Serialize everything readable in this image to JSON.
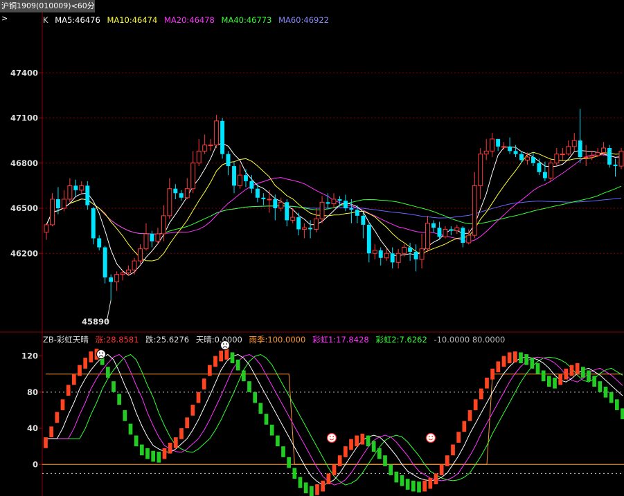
{
  "title": "沪铜1909(010009)<60分>",
  "main_legend": {
    "k": "K",
    "ma5": "MA5:46476",
    "ma10": "MA10:46474",
    "ma20": "MA20:46478",
    "ma40": "MA40:46773",
    "ma60": "MA60:46922"
  },
  "indicator_legend": {
    "name": "ZB-彩虹天晴",
    "zhang": "涨:28.8581",
    "die": "跌:25.6276",
    "tianqing": "天晴:0.0000",
    "yuji": "雨季:100.0000",
    "caihong1": "彩虹1:17.8428",
    "caihong2": "彩虹2:7.6262",
    "levels": "-10.0000 80.0000"
  },
  "colors": {
    "up": "#ff3b3b",
    "down": "#00e5ff",
    "ma5": "#ffffff",
    "ma10": "#ffff33",
    "ma20": "#ff33ff",
    "ma40": "#33ff33",
    "ma60": "#6666ff",
    "grid": "#8b0000",
    "orange": "#ff9933"
  },
  "chart_data": [
    {
      "type": "candlestick",
      "y_ticks": [
        "47400",
        "47100",
        "46800",
        "46500",
        "46200"
      ],
      "ylim": [
        45700,
        47700
      ],
      "low_label": "45890",
      "candles": [
        [
          46340,
          46390,
          46290,
          46400
        ],
        [
          46390,
          46560,
          46380,
          46600
        ],
        [
          46560,
          46500,
          46460,
          46640
        ],
        [
          46500,
          46560,
          46480,
          46620
        ],
        [
          46560,
          46650,
          46540,
          46700
        ],
        [
          46650,
          46620,
          46580,
          46690
        ],
        [
          46620,
          46650,
          46600,
          46680
        ],
        [
          46650,
          46520,
          46490,
          46680
        ],
        [
          46500,
          46300,
          46260,
          46510
        ],
        [
          46300,
          46240,
          46220,
          46320
        ],
        [
          46240,
          46040,
          46000,
          46250
        ],
        [
          46040,
          46010,
          45890,
          46060
        ],
        [
          46010,
          46060,
          45950,
          46080
        ],
        [
          46060,
          46070,
          46020,
          46090
        ],
        [
          46070,
          46090,
          46050,
          46120
        ],
        [
          46090,
          46150,
          46060,
          46170
        ],
        [
          46150,
          46230,
          46130,
          46260
        ],
        [
          46230,
          46330,
          46220,
          46400
        ],
        [
          46330,
          46280,
          46240,
          46350
        ],
        [
          46280,
          46330,
          46260,
          46370
        ],
        [
          46330,
          46450,
          46280,
          46520
        ],
        [
          46450,
          46630,
          46430,
          46700
        ],
        [
          46630,
          46600,
          46560,
          46660
        ],
        [
          46600,
          46570,
          46550,
          46620
        ],
        [
          46570,
          46630,
          46560,
          46700
        ],
        [
          46630,
          46800,
          46600,
          46880
        ],
        [
          46800,
          46880,
          46780,
          46960
        ],
        [
          46880,
          46920,
          46860,
          46990
        ],
        [
          46920,
          46920,
          46880,
          46960
        ],
        [
          46920,
          47080,
          46900,
          47120
        ],
        [
          47080,
          46860,
          46830,
          47100
        ],
        [
          46860,
          46780,
          46720,
          46880
        ],
        [
          46780,
          46650,
          46600,
          46810
        ],
        [
          46650,
          46720,
          46630,
          46790
        ],
        [
          46720,
          46680,
          46640,
          46760
        ],
        [
          46680,
          46630,
          46600,
          46720
        ],
        [
          46630,
          46570,
          46540,
          46660
        ],
        [
          46570,
          46560,
          46520,
          46600
        ],
        [
          46560,
          46560,
          46470,
          46620
        ],
        [
          46560,
          46500,
          46420,
          46590
        ],
        [
          46500,
          46540,
          46480,
          46570
        ],
        [
          46540,
          46420,
          46380,
          46560
        ],
        [
          46420,
          46440,
          46400,
          46500
        ],
        [
          46440,
          46360,
          46320,
          46470
        ],
        [
          46360,
          46370,
          46300,
          46400
        ],
        [
          46370,
          46360,
          46300,
          46420
        ],
        [
          46360,
          46430,
          46340,
          46500
        ],
        [
          46430,
          46540,
          46400,
          46580
        ],
        [
          46540,
          46530,
          46500,
          46600
        ],
        [
          46530,
          46560,
          46500,
          46600
        ],
        [
          46560,
          46550,
          46510,
          46580
        ],
        [
          46550,
          46500,
          46480,
          46590
        ],
        [
          46500,
          46490,
          46400,
          46560
        ],
        [
          46490,
          46450,
          46400,
          46520
        ],
        [
          46450,
          46390,
          46300,
          46470
        ],
        [
          46390,
          46200,
          46140,
          46400
        ],
        [
          46200,
          46220,
          46160,
          46260
        ],
        [
          46220,
          46170,
          46120,
          46240
        ],
        [
          46170,
          46200,
          46150,
          46230
        ],
        [
          46200,
          46140,
          46100,
          46240
        ],
        [
          46140,
          46200,
          46100,
          46230
        ],
        [
          46200,
          46240,
          46180,
          46260
        ],
        [
          46240,
          46210,
          46150,
          46270
        ],
        [
          46210,
          46160,
          46080,
          46260
        ],
        [
          46160,
          46230,
          46100,
          46330
        ],
        [
          46230,
          46400,
          46210,
          46450
        ],
        [
          46400,
          46370,
          46340,
          46420
        ],
        [
          46370,
          46310,
          46290,
          46410
        ],
        [
          46310,
          46360,
          46300,
          46380
        ],
        [
          46360,
          46350,
          46320,
          46380
        ],
        [
          46350,
          46370,
          46330,
          46390
        ],
        [
          46370,
          46270,
          46240,
          46380
        ],
        [
          46270,
          46320,
          46260,
          46360
        ],
        [
          46320,
          46650,
          46300,
          46740
        ],
        [
          46650,
          46860,
          46560,
          46900
        ],
        [
          46860,
          46880,
          46820,
          46960
        ],
        [
          46880,
          46960,
          46840,
          47000
        ],
        [
          46960,
          46910,
          46880,
          46960
        ],
        [
          46910,
          46910,
          46890,
          46940
        ],
        [
          46910,
          46880,
          46860,
          46970
        ],
        [
          46880,
          46860,
          46840,
          46920
        ],
        [
          46860,
          46820,
          46800,
          46880
        ],
        [
          46820,
          46840,
          46790,
          46870
        ],
        [
          46840,
          46800,
          46780,
          46870
        ],
        [
          46800,
          46740,
          46720,
          46830
        ],
        [
          46740,
          46700,
          46680,
          46810
        ],
        [
          46700,
          46800,
          46680,
          46830
        ],
        [
          46800,
          46860,
          46780,
          46900
        ],
        [
          46860,
          46860,
          46820,
          46900
        ],
        [
          46860,
          46910,
          46850,
          46950
        ],
        [
          46910,
          46950,
          46880,
          47000
        ],
        [
          46950,
          46840,
          46800,
          47160
        ],
        [
          46840,
          46840,
          46780,
          46920
        ],
        [
          46840,
          46850,
          46820,
          46880
        ],
        [
          46850,
          46870,
          46840,
          46900
        ],
        [
          46870,
          46900,
          46850,
          46940
        ],
        [
          46900,
          46790,
          46770,
          46920
        ],
        [
          46790,
          46780,
          46710,
          46830
        ],
        [
          46780,
          46880,
          46760,
          46900
        ]
      ]
    },
    {
      "type": "oscillator",
      "name": "ZB-彩虹天晴",
      "y_ticks": [
        "120",
        "80",
        "40",
        "0"
      ],
      "ylim": [
        -35,
        135
      ],
      "levels": [
        -10,
        80
      ],
      "bars": [
        30,
        42,
        58,
        72,
        88,
        100,
        110,
        118,
        125,
        128,
        122,
        108,
        92,
        78,
        60,
        45,
        32,
        22,
        18,
        15,
        14,
        18,
        24,
        30,
        40,
        52,
        66,
        80,
        95,
        110,
        120,
        126,
        128,
        124,
        116,
        104,
        92,
        80,
        68,
        56,
        44,
        32,
        20,
        8,
        -4,
        -14,
        -20,
        -24,
        -22,
        -18,
        -10,
        0,
        10,
        20,
        28,
        32,
        34,
        32,
        26,
        18,
        10,
        0,
        -8,
        -12,
        -16,
        -18,
        -19,
        -18,
        -15,
        -10,
        0,
        10,
        22,
        36,
        48,
        60,
        72,
        84,
        96,
        106,
        114,
        120,
        124,
        125,
        124,
        122,
        118,
        112,
        104,
        98,
        96,
        100,
        106,
        110,
        112,
        108,
        104,
        98,
        92,
        86,
        80,
        72,
        62
      ]
    }
  ]
}
